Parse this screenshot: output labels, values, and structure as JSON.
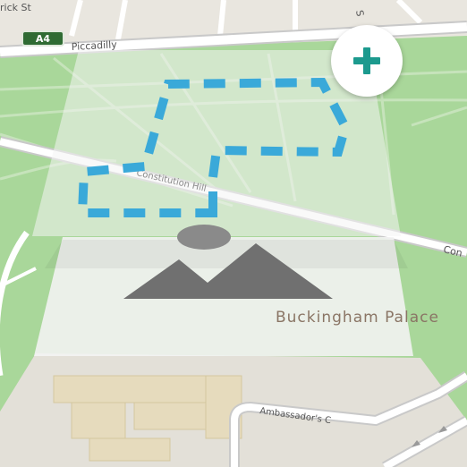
{
  "map": {
    "road_labels": {
      "top_left_street": "rick St",
      "piccadilly": "Piccadilly",
      "constitution_hill": "Constitution Hill",
      "constitution_right": "Con",
      "ambassadors_court": "Ambassador's C",
      "top_right_fragment": "S"
    },
    "road_shield": "A4",
    "place_label": "Buckingham Palace",
    "colors": {
      "park": "#a9d79a",
      "road": "#ffffff",
      "road_casing": "#c9c9c9",
      "road_shield_bg": "#2f6b33",
      "polygon_stroke": "#3aa9d9",
      "add_icon": "#1c9a8e",
      "building": "#e6dbbd"
    }
  },
  "controls": {
    "add_button_icon": "plus-icon"
  },
  "layers": {
    "layer_icons": [
      "polygon-drawing-layer-icon",
      "image-layer-icon"
    ]
  }
}
